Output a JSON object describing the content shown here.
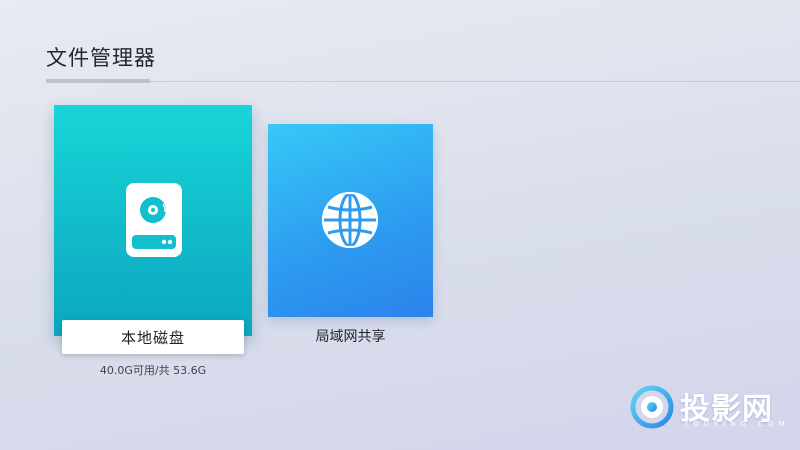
{
  "header": {
    "title": "文件管理器"
  },
  "tiles": [
    {
      "label": "本地磁盘",
      "icon": "hard-drive-icon",
      "storage_info": "40.0G可用/共 53.6G",
      "focused": true,
      "color": "#12c3cf"
    },
    {
      "label": "局域网共享",
      "icon": "globe-icon",
      "focused": false,
      "color": "#2f9bf1"
    }
  ],
  "watermark": {
    "text": "投影网",
    "sub": "TOUYING.COM",
    "icon": "touying-logo-icon"
  }
}
